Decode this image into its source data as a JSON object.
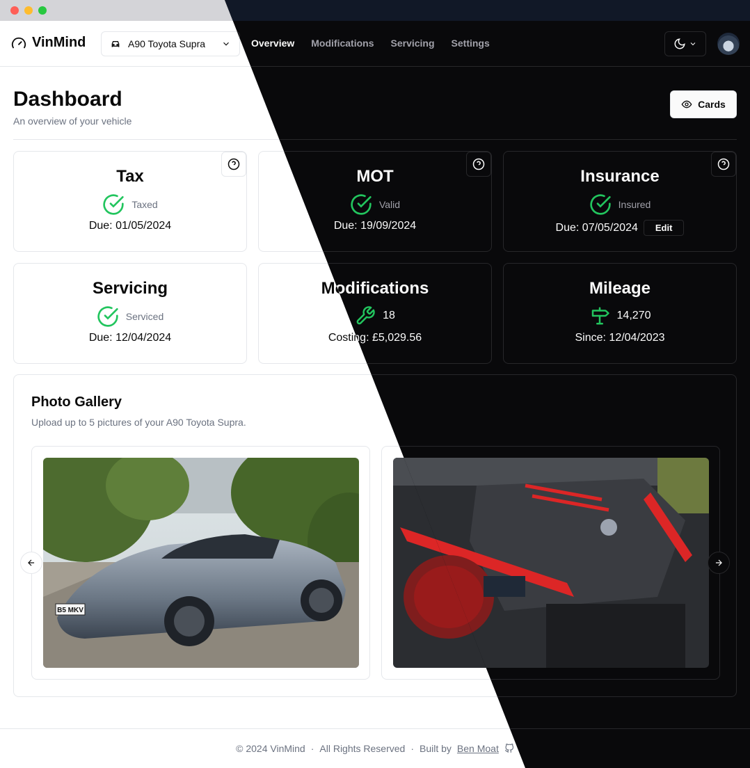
{
  "app": {
    "brand": "VinMind"
  },
  "vehicle": {
    "name": "A90 Toyota Supra"
  },
  "nav": {
    "items": [
      "Overview",
      "Modifications",
      "Servicing",
      "Settings"
    ],
    "active": "Overview"
  },
  "page": {
    "title": "Dashboard",
    "subtitle": "An overview of your vehicle",
    "cards_button": "Cards"
  },
  "cards": {
    "tax": {
      "title": "Tax",
      "status": "Taxed",
      "due": "Due: 01/05/2024"
    },
    "mot": {
      "title": "MOT",
      "status": "Valid",
      "due": "Due: 19/09/2024"
    },
    "insurance": {
      "title": "Insurance",
      "status": "Insured",
      "due": "Due: 07/05/2024",
      "edit": "Edit"
    },
    "servicing": {
      "title": "Servicing",
      "status": "Serviced",
      "due": "Due: 12/04/2024"
    },
    "modifications": {
      "title": "Modifications",
      "count": "18",
      "costing": "Costing: £5,029.56"
    },
    "mileage": {
      "title": "Mileage",
      "value": "14,270",
      "since": "Since: 12/04/2023"
    }
  },
  "gallery": {
    "title": "Photo Gallery",
    "subtitle": "Upload up to 5 pictures of your A90 Toyota Supra.",
    "plate": "B5 MKV"
  },
  "footer": {
    "copyright": "© 2024 VinMind",
    "rights": "All Rights Reserved",
    "built_by": "Built by",
    "author": "Ben Moat",
    "sep": "·"
  },
  "colors": {
    "success": "#22c55e",
    "accent_red": "#dc2626"
  }
}
